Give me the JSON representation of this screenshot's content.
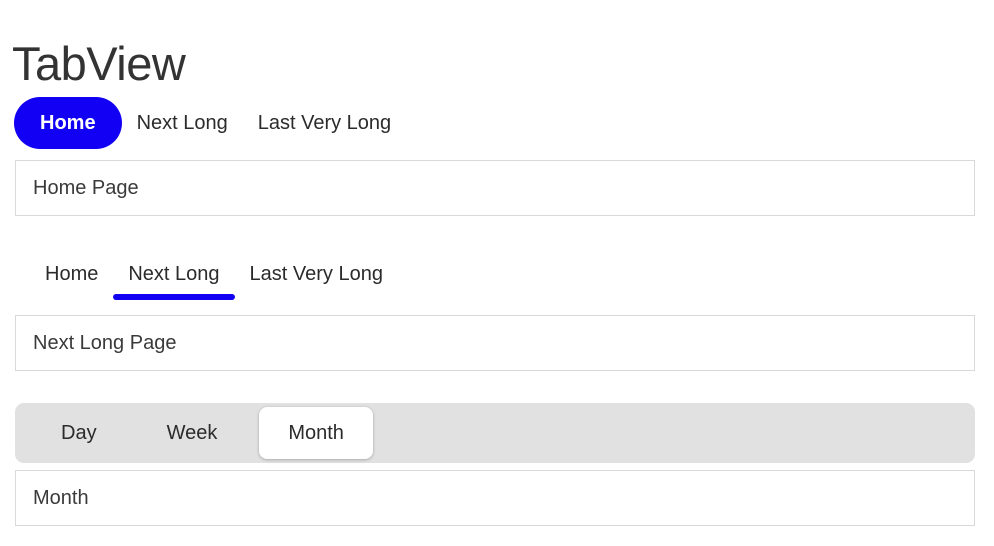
{
  "page": {
    "title": "TabView"
  },
  "theme": {
    "accent": "#1200f5",
    "segment_track": "#e1e1e1",
    "panel_border": "#d9d9d9",
    "text": "#333333",
    "active_pill_text": "#ffffff"
  },
  "sections": [
    {
      "id": "pill",
      "style": "pill",
      "tabs": [
        {
          "label": "Home",
          "active": true
        },
        {
          "label": "Next Long",
          "active": false
        },
        {
          "label": "Last Very Long",
          "active": false
        }
      ],
      "panel": {
        "text": "Home Page"
      }
    },
    {
      "id": "underline",
      "style": "underline",
      "tabs": [
        {
          "label": "Home",
          "active": false
        },
        {
          "label": "Next Long",
          "active": true
        },
        {
          "label": "Last Very Long",
          "active": false
        }
      ],
      "panel": {
        "text": "Next Long Page"
      }
    },
    {
      "id": "segmented",
      "style": "segmented",
      "tabs": [
        {
          "label": "Day",
          "active": false
        },
        {
          "label": "Week",
          "active": false
        },
        {
          "label": "Month",
          "active": true
        }
      ],
      "panel": {
        "text": "Month"
      }
    }
  ]
}
